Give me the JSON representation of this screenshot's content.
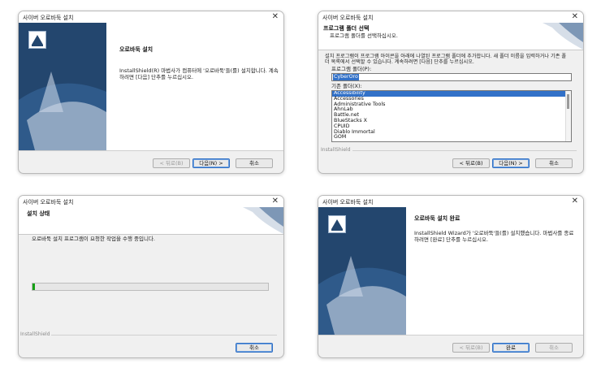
{
  "welcome": {
    "title": "사이버 오로바둑 설치",
    "heading": "오로바둑 설치",
    "body": "InstallShield(R) 마법사가 컴퓨터에 '오로바둑'들(를) 설치합니다. 계속하려면 [다음] 단추를 누르십시오.",
    "back": "< 뒤로(B)",
    "next": "다음(N) >",
    "cancel": "취소"
  },
  "folder": {
    "title": "사이버 오로바둑 설치",
    "heading": "프로그램 폴더 선택",
    "subheading": "프로그램 폴더를 선택하십시오.",
    "body": "설치 프로그램이 프로그램 아이콘을 아래에 나열된 프로그램 폴더에 추가합니다. 새 폴더 이름을 입력하거나 기존 폴더 목록에서 선택할 수 있습니다. 계속하려면 [다음] 단추를 누르십시오.",
    "program_folder_label": "프로그램 폴더(P):",
    "program_folder_value": "CyberOro",
    "existing_label": "기존 폴더(X):",
    "folders": [
      "Accessibility",
      "Accessories",
      "Administrative Tools",
      "AhnLab",
      "Battle.net",
      "BlueStacks X",
      "CPUID",
      "Diablo Immortal",
      "GOM"
    ],
    "brand": "InstallShield",
    "back": "< 뒤로(B)",
    "next": "다음(N) >",
    "cancel": "취소"
  },
  "progress": {
    "title": "사이버 오로바둑 설치",
    "heading": "설치 상태",
    "status": "오로바둑 설치 프로그램이 요청한 작업을 수행 중입니다.",
    "progress_fraction": 0.01,
    "brand": "InstallShield",
    "cancel": "취소"
  },
  "complete": {
    "title": "사이버 오로바둑 설치",
    "heading": "오로바둑 설치 완료",
    "body": "InstallShield Wizard가 '오로바둑'들(를) 설치했습니다. 마법사를 종료하려면 [완료] 단추를 누르십시오.",
    "back": "< 뒤로(B)",
    "finish": "완료",
    "cancel": "취소"
  }
}
